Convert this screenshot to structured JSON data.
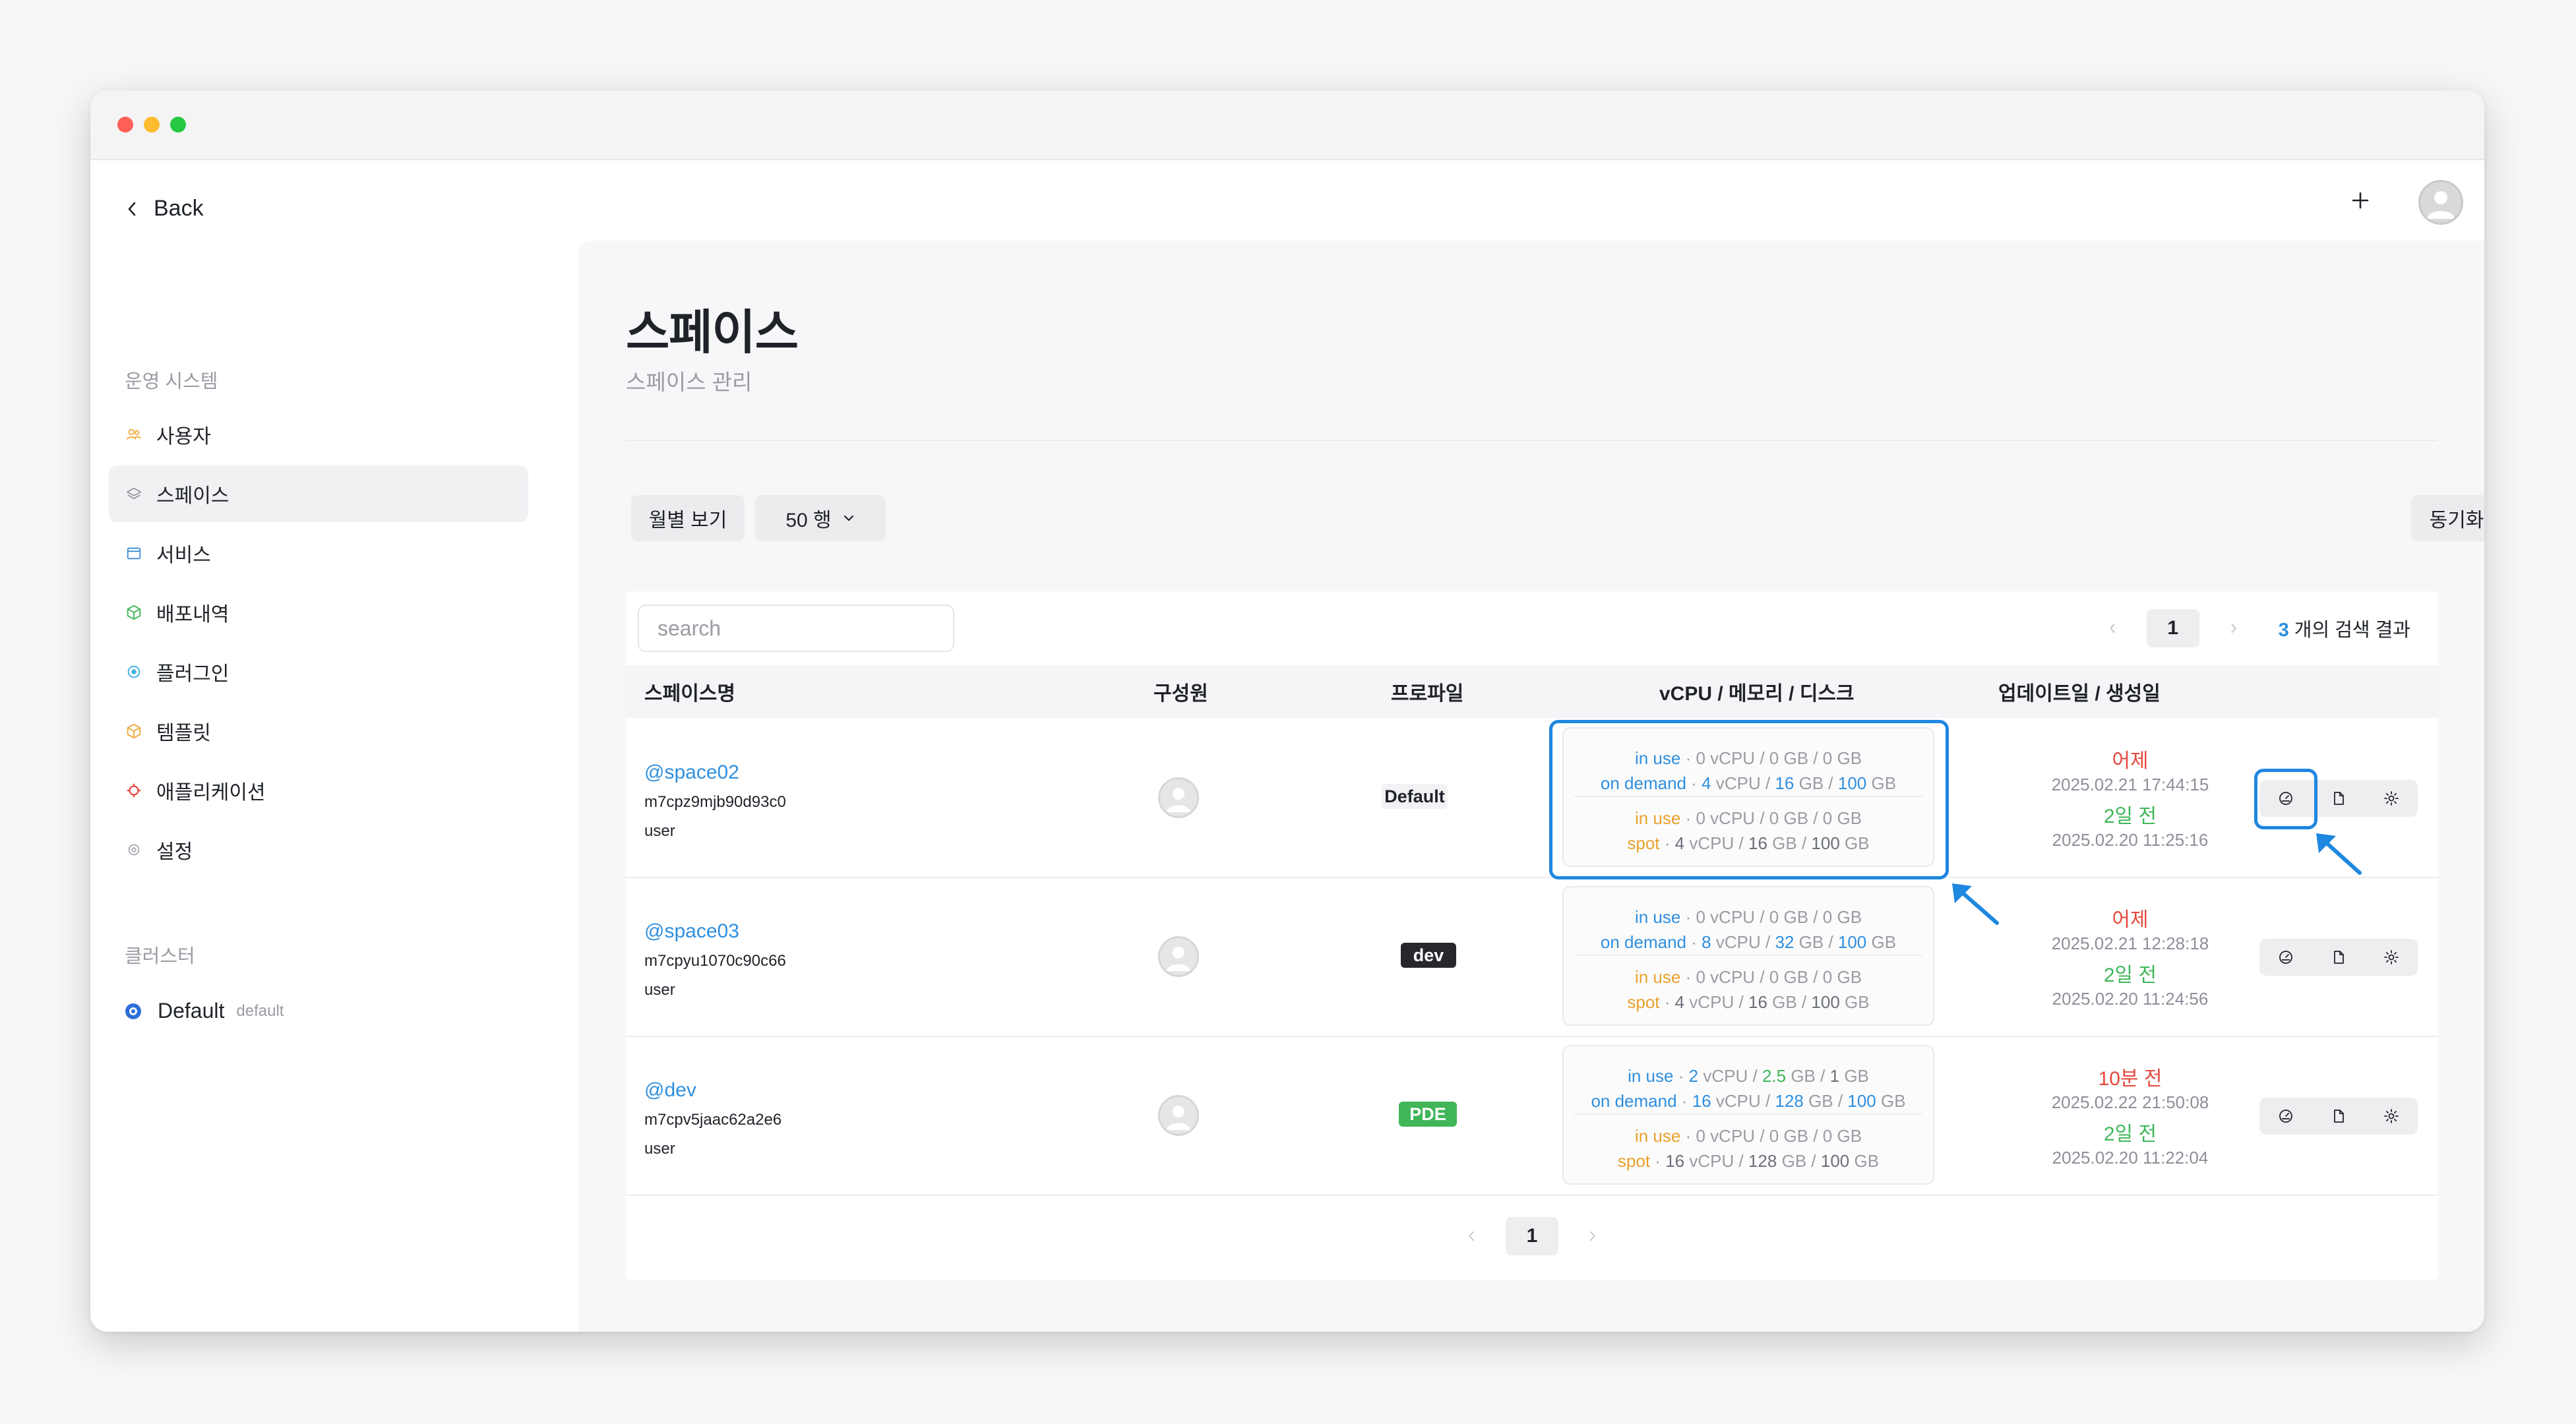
{
  "nav": {
    "back_label": "Back",
    "section_system": "운영 시스템",
    "items": [
      {
        "label": "사용자",
        "icon": "users-icon",
        "active": false
      },
      {
        "label": "스페이스",
        "icon": "layers-icon",
        "active": true
      },
      {
        "label": "서비스",
        "icon": "window-icon",
        "active": false
      },
      {
        "label": "배포내역",
        "icon": "cube-icon",
        "active": false
      },
      {
        "label": "플러그인",
        "icon": "plugin-icon",
        "active": false
      },
      {
        "label": "템플릿",
        "icon": "template-icon",
        "active": false
      },
      {
        "label": "애플리케이션",
        "icon": "app-icon",
        "active": false
      },
      {
        "label": "설정",
        "icon": "settings-icon",
        "active": false
      }
    ],
    "section_cluster": "클러스터",
    "cluster": {
      "name": "Default",
      "tag": "default"
    }
  },
  "page": {
    "title": "스페이스",
    "subtitle": "스페이스 관리"
  },
  "toolbar": {
    "monthly_view": "월별 보기",
    "rows": "50 행",
    "sync": "동기화"
  },
  "table": {
    "search_placeholder": "search",
    "current_page": "1",
    "result_count": "3",
    "result_label": "개의 검색 결과",
    "headers": {
      "name": "스페이스명",
      "members": "구성원",
      "profile": "프로파일",
      "resources": "vCPU / 메모리 / 디스크",
      "dates": "업데이트일 / 생성일"
    },
    "rows": [
      {
        "name": "@space02",
        "id": "m7cpz9mjb90d93c0",
        "role": "user",
        "profile": "Default",
        "ondemand_inuse": {
          "label": "in use",
          "cpu": "0",
          "mem": "0",
          "disk": "0"
        },
        "ondemand": {
          "label": "on demand",
          "cpu": "4",
          "mem": "16",
          "disk": "100"
        },
        "spot_inuse": {
          "label": "in use",
          "cpu": "0",
          "mem": "0",
          "disk": "0"
        },
        "spot": {
          "label": "spot",
          "cpu": "4",
          "mem": "16",
          "disk": "100"
        },
        "updated_rel": "어제",
        "updated_at": "2025.02.21 17:44:15",
        "created_rel": "2일 전",
        "created_at": "2025.02.20 11:25:16"
      },
      {
        "name": "@space03",
        "id": "m7cpyu1070c90c66",
        "role": "user",
        "profile": "dev",
        "ondemand_inuse": {
          "label": "in use",
          "cpu": "0",
          "mem": "0",
          "disk": "0"
        },
        "ondemand": {
          "label": "on demand",
          "cpu": "8",
          "mem": "32",
          "disk": "100"
        },
        "spot_inuse": {
          "label": "in use",
          "cpu": "0",
          "mem": "0",
          "disk": "0"
        },
        "spot": {
          "label": "spot",
          "cpu": "4",
          "mem": "16",
          "disk": "100"
        },
        "updated_rel": "어제",
        "updated_at": "2025.02.21 12:28:18",
        "created_rel": "2일 전",
        "created_at": "2025.02.20 11:24:56"
      },
      {
        "name": "@dev",
        "id": "m7cpv5jaac62a2e6",
        "role": "user",
        "profile": "PDE",
        "ondemand_inuse": {
          "label": "in use",
          "cpu": "2",
          "mem": "2.5",
          "disk": "1"
        },
        "ondemand": {
          "label": "on demand",
          "cpu": "16",
          "mem": "128",
          "disk": "100"
        },
        "spot_inuse": {
          "label": "in use",
          "cpu": "0",
          "mem": "0",
          "disk": "0"
        },
        "spot": {
          "label": "spot",
          "cpu": "16",
          "mem": "128",
          "disk": "100"
        },
        "updated_rel": "10분 전",
        "updated_at": "2025.02.22 21:50:08",
        "created_rel": "2일 전",
        "created_at": "2025.02.20 11:22:04"
      }
    ],
    "units": {
      "sep": "·",
      "vcpu": "vCPU",
      "gb": "GB",
      "slash": "/"
    }
  },
  "colors": {
    "accent": "#2f8fde",
    "highlight": "#1e87e0",
    "in_use": "#2f8fde",
    "spot": "#e9a12b",
    "recent_red": "#e5483d",
    "created_green": "#40b659"
  }
}
